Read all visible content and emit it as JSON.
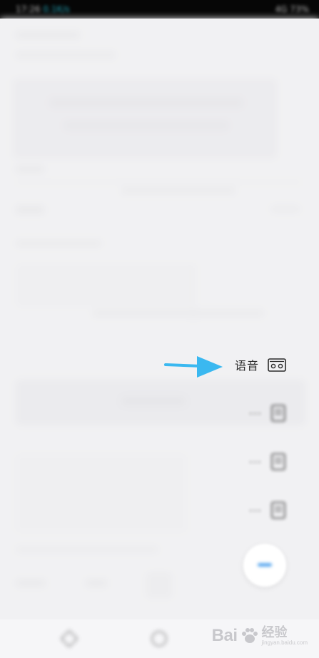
{
  "status_bar": {
    "time": "17:26",
    "network": "0.1K/s",
    "right": "4G 73%"
  },
  "menu": {
    "items": [
      {
        "label": "语音",
        "icon": "radio-icon",
        "blurred": false
      },
      {
        "label": "···",
        "icon": "document-icon",
        "blurred": true
      },
      {
        "label": "···",
        "icon": "document-icon",
        "blurred": true
      },
      {
        "label": "···",
        "icon": "document-icon",
        "blurred": true
      }
    ]
  },
  "annotation": {
    "arrow_color": "#3ab8f0"
  },
  "fab": {
    "icon": "more-icon",
    "accent": "#5aa8ee"
  },
  "navigation_bar": {
    "back_icon": "back-icon",
    "home_icon": "home-icon"
  },
  "watermark": {
    "brand": "Bai",
    "brand_cn": "经验",
    "url": "jingyan.baidu.com"
  }
}
